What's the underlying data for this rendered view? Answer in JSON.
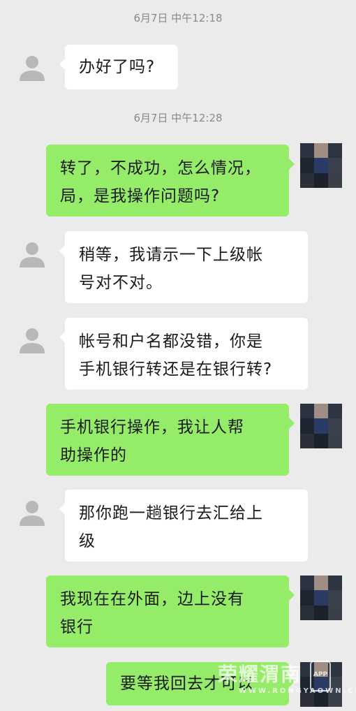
{
  "timestamps": [
    "6月7日 中午12:18",
    "6月7日 中午12:28"
  ],
  "messages": [
    {
      "side": "in",
      "text": "办好了吗?"
    },
    {
      "side": "out",
      "text": "转了，不成功，怎么情况，\n局，是我操作问题吗?"
    },
    {
      "side": "in",
      "text": "稍等，我请示一下上级帐\n号对不对。"
    },
    {
      "side": "in",
      "text": "帐号和户名都没错，你是\n手机银行转还是在银行转?"
    },
    {
      "side": "out",
      "text": "手机银行操作，我让人帮\n助操作的"
    },
    {
      "side": "in",
      "text": "那你跑一趟银行去汇给上\n级"
    },
    {
      "side": "out",
      "text": "我现在在外面，边上没有\n银行"
    },
    {
      "side": "out",
      "text": "要等我回去才可以"
    }
  ],
  "watermark": {
    "text": "荣耀渭南",
    "url": "WWW.RONGYAOWN.CN",
    "app": "APP"
  },
  "colors": {
    "background": "#ebebeb",
    "incoming": "#ffffff",
    "outgoing": "#95ec69",
    "timestamp": "#8a8a8a"
  },
  "icons": {
    "incoming_avatar": "person-silhouette-icon",
    "outgoing_avatar": "pixelated-photo-avatar"
  }
}
